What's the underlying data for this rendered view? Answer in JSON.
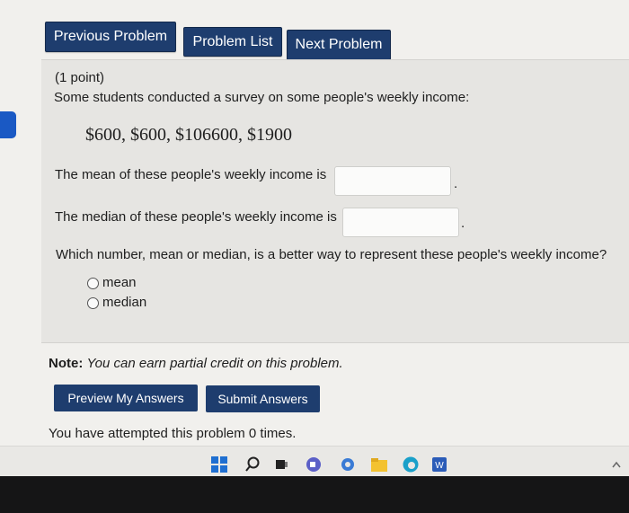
{
  "nav": {
    "previous": "Previous Problem",
    "list": "Problem List",
    "next": "Next Problem"
  },
  "problem": {
    "points": "(1 point)",
    "intro": "Some students conducted a survey on some people's weekly income:",
    "data_values": "$600,  $600,  $106600,  $1900",
    "mean_label": "The mean of these people's weekly income is",
    "mean_value": "",
    "median_label": "The median of these people's weekly income is",
    "median_value": "",
    "question": "Which number, mean or median, is a better way to represent these people's weekly income?",
    "options": [
      "mean",
      "median"
    ]
  },
  "note": {
    "label": "Note:",
    "text": "You can earn partial credit on this problem."
  },
  "actions": {
    "preview": "Preview My Answers",
    "submit": "Submit Answers"
  },
  "attempts": "You have attempted this problem 0 times.",
  "taskbar": {
    "icons": [
      "windows-start-icon",
      "search-icon",
      "task-view-icon",
      "chat-icon",
      "settings-icon",
      "file-explorer-icon",
      "edge-icon",
      "word-icon"
    ]
  },
  "colors": {
    "button": "#1e3d6e",
    "page_bg": "#f1f0ed",
    "problem_bg": "#e6e5e2",
    "accent_tab": "#1a59c4"
  }
}
